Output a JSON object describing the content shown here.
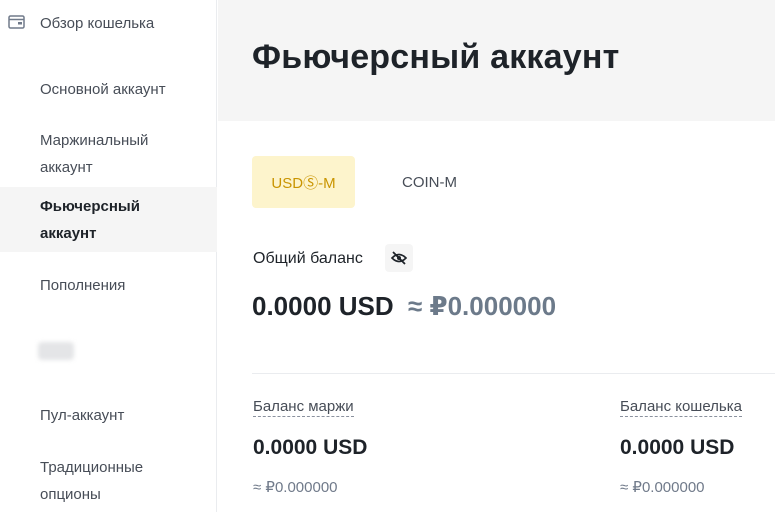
{
  "sidebar": {
    "overview_label": "Обзор кошелька",
    "items": [
      {
        "label": "Основной аккаунт"
      },
      {
        "label": "Маржинальный аккаунт"
      },
      {
        "label": "Фьючерсный аккаунт"
      },
      {
        "label": "Пополнения"
      },
      {
        "label": "Пул-аккаунт"
      },
      {
        "label": "Традиционные опционы"
      }
    ]
  },
  "header": {
    "title": "Фьючерсный аккаунт"
  },
  "tabs": [
    {
      "label": "USDⓈ-M",
      "active": true
    },
    {
      "label": "COIN-M",
      "active": false
    }
  ],
  "balance": {
    "total_label": "Общий баланс",
    "total_value": "0.0000 USD",
    "total_approx": "≈ ₽0.000000",
    "margin_label": "Баланс маржи",
    "margin_value": "0.0000 USD",
    "margin_approx": "≈ ₽0.000000",
    "wallet_label": "Баланс кошелька",
    "wallet_value": "0.0000 USD",
    "wallet_approx": "≈ ₽0.000000"
  },
  "colors": {
    "accent_bg": "#fdf4cc",
    "accent_text": "#c99400",
    "active_bg": "#f5f5f5"
  },
  "icons": [
    "wallet-icon",
    "eye-slash-icon"
  ]
}
